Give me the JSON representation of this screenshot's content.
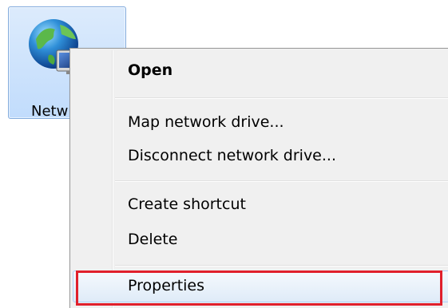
{
  "desktop_icon": {
    "label": "Netw",
    "icon": "network-globe-icon",
    "selected": true
  },
  "context_menu": {
    "items": [
      {
        "label": "Open",
        "default": true
      },
      {
        "label": "Map network drive..."
      },
      {
        "label": "Disconnect network drive..."
      },
      {
        "label": "Create shortcut"
      },
      {
        "label": "Delete"
      },
      {
        "label": "Properties",
        "highlighted": true
      }
    ]
  },
  "colors": {
    "highlight_border": "#e0202c",
    "menu_background": "#f0f0f0",
    "selection_fill": "#c1dcfc"
  }
}
